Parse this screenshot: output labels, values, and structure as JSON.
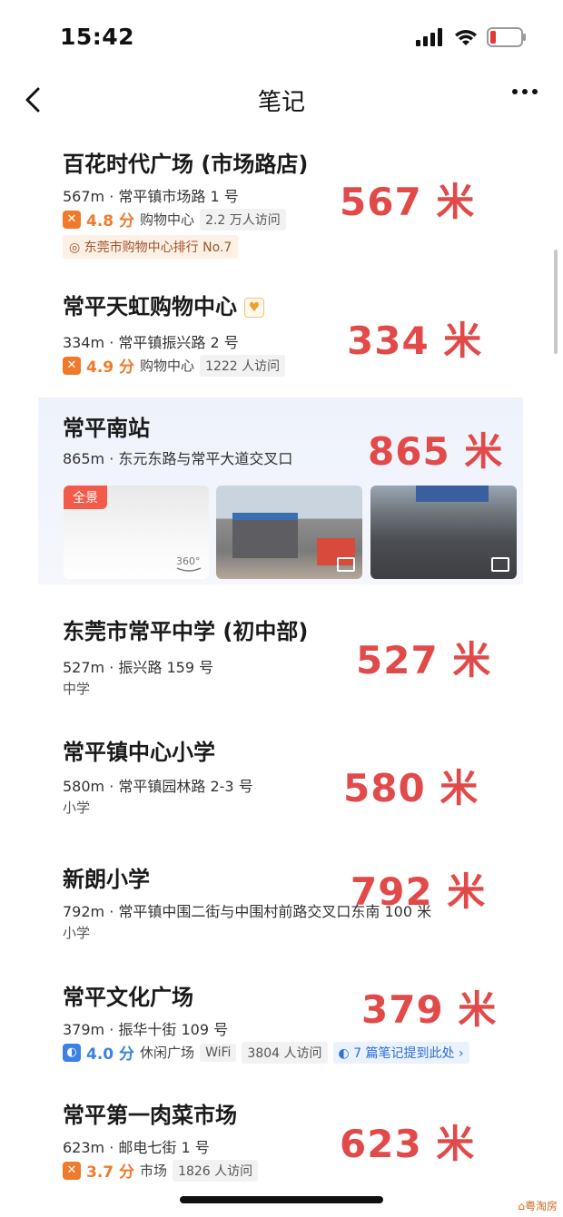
{
  "status": {
    "time": "15:42"
  },
  "nav": {
    "title": "笔记"
  },
  "items": [
    {
      "title": "百花时代广场 (市场路店)",
      "address": "567m · 常平镇市场路 1 号",
      "rating": "4.8 分",
      "category": "购物中心",
      "visits": "2.2 万人访问",
      "rank": "东莞市购物中心排行 No.7",
      "distance": "567 米"
    },
    {
      "title": "常平天虹购物中心",
      "address": "334m · 常平镇振兴路 2 号",
      "rating": "4.9 分",
      "category": "购物中心",
      "visits": "1222 人访问",
      "distance": "334 米"
    },
    {
      "title": "常平南站",
      "address": "865m · 东元东路与常平大道交叉口",
      "pano": "全景",
      "distance": "865 米"
    },
    {
      "title": "东莞市常平中学 (初中部)",
      "address": "527m · 振兴路 159 号",
      "type": "中学",
      "distance": "527 米"
    },
    {
      "title": "常平镇中心小学",
      "address": "580m · 常平镇园林路 2-3 号",
      "type": "小学",
      "distance": "580 米"
    },
    {
      "title": "新朗小学",
      "address": "792m · 常平镇中围二街与中围村前路交叉口东南 100 米",
      "type": "小学",
      "distance": "792 米"
    },
    {
      "title": "常平文化广场",
      "address": "379m · 振华十街 109 号",
      "rating": "4.0 分",
      "category": "休闲广场",
      "wifi": "WiFi",
      "visits": "3804 人访问",
      "notes": "7 篇笔记提到此处",
      "distance": "379 米"
    },
    {
      "title": "常平第一肉菜市场",
      "address": "623m · 邮电七街 1 号",
      "rating": "3.7 分",
      "category": "市场",
      "visits": "1826 人访问",
      "distance": "623 米"
    }
  ],
  "watermark": "粤淘房",
  "colors": {
    "distance_red": "#e24a4a",
    "rating_orange": "#f07a2c",
    "rating_blue": "#3b82e6"
  }
}
